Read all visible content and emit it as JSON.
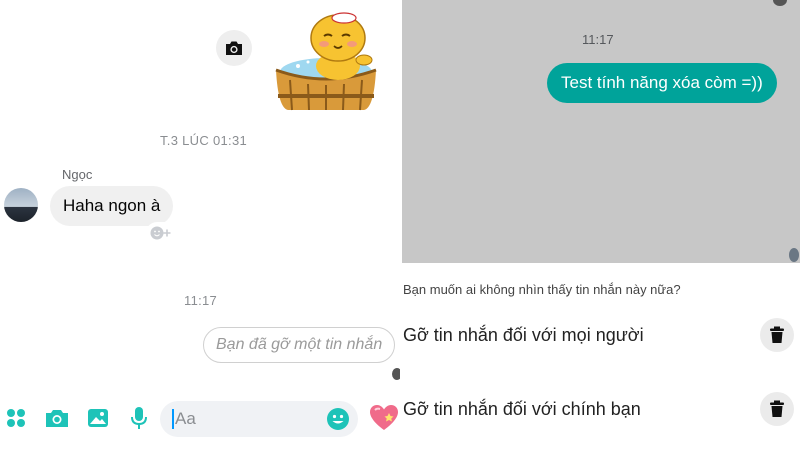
{
  "left": {
    "camera_fab_icon": "camera-icon",
    "sticker": "bath-tub-character-sticker",
    "timestamp_top": "T.3 LÚC 01:31",
    "sender_name": "Ngọc",
    "incoming_message": "Haha ngon à",
    "reaction_icon": "add-reaction-icon",
    "timestamp_mid": "11:17",
    "removed_notice": "Bạn đã gỡ một tin nhắn",
    "composer": {
      "placeholder": "Aa",
      "icons": [
        "apps-grid-icon",
        "camera-icon",
        "image-icon",
        "microphone-icon",
        "emoji-icon",
        "heart-icon"
      ]
    }
  },
  "right": {
    "timestamp": "11:17",
    "outgoing_message": "Test tính năng xóa còm =))",
    "prompt": "Bạn muốn ai không nhìn thấy tin nhắn này nữa?",
    "options": [
      {
        "label": "Gỡ tin nhắn đối với mọi người",
        "icon": "trash-icon"
      },
      {
        "label": "Gỡ tin nhắn đối với chính bạn",
        "icon": "trash-icon"
      }
    ]
  },
  "colors": {
    "accent": "#1ec3b8",
    "outgoing_bubble": "#00a39a",
    "overlay": "#c7c7c7",
    "incoming_bubble": "#f0f0f0"
  }
}
